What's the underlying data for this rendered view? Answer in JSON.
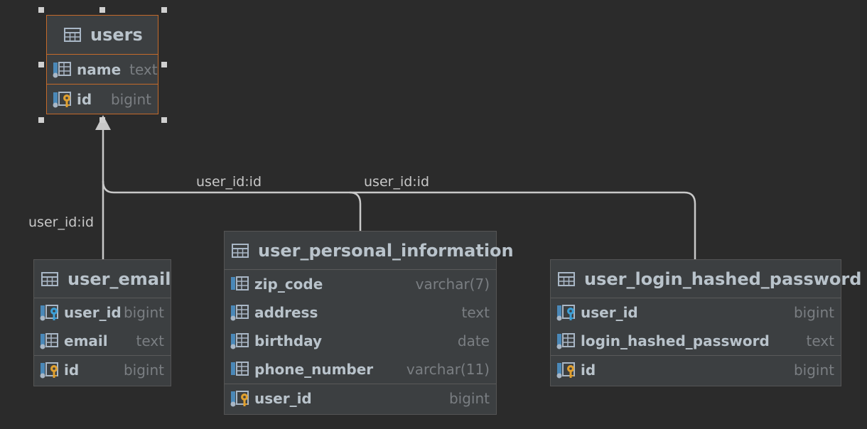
{
  "tables": {
    "users": {
      "name": "users",
      "columns": [
        {
          "name": "name",
          "type": "text",
          "kind": "column"
        },
        {
          "name": "id",
          "type": "bigint",
          "kind": "primary-key"
        }
      ]
    },
    "user_email": {
      "name": "user_email",
      "columns": [
        {
          "name": "user_id",
          "type": "bigint",
          "kind": "foreign-key"
        },
        {
          "name": "email",
          "type": "text",
          "kind": "column"
        },
        {
          "name": "id",
          "type": "bigint",
          "kind": "primary-key"
        }
      ]
    },
    "user_personal_information": {
      "name": "user_personal_information",
      "columns": [
        {
          "name": "zip_code",
          "type": "varchar(7)",
          "kind": "column"
        },
        {
          "name": "address",
          "type": "text",
          "kind": "column"
        },
        {
          "name": "birthday",
          "type": "date",
          "kind": "column"
        },
        {
          "name": "phone_number",
          "type": "varchar(11)",
          "kind": "column"
        },
        {
          "name": "user_id",
          "type": "bigint",
          "kind": "primary-key"
        }
      ]
    },
    "user_login_hashed_password": {
      "name": "user_login_hashed_password",
      "columns": [
        {
          "name": "user_id",
          "type": "bigint",
          "kind": "foreign-key"
        },
        {
          "name": "login_hashed_password",
          "type": "text",
          "kind": "column"
        },
        {
          "name": "id",
          "type": "bigint",
          "kind": "primary-key"
        }
      ]
    }
  },
  "relations": {
    "email_to_users": "user_id:id",
    "personal_to_users": "user_id:id",
    "password_to_users": "user_id:id"
  },
  "colors": {
    "background": "#2b2b2b",
    "table_fill": "#3c3f41",
    "selected_border": "#c46a2a",
    "connector": "#c8c8c8",
    "primary_key_icon": "#e0a030",
    "foreign_key_icon": "#3d9fd6"
  }
}
